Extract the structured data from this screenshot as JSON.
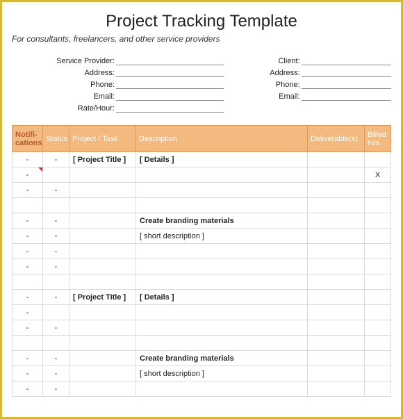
{
  "title": "Project Tracking Template",
  "subtitle": "For consultants, freelancers, and other service providers",
  "info_left": {
    "service_provider": "Service Provider:",
    "address": "Address:",
    "phone": "Phone:",
    "email": "Email:",
    "rate": "Rate/Hour:"
  },
  "info_right": {
    "client": "Client:",
    "address": "Address:",
    "phone": "Phone:",
    "email": "Email:"
  },
  "headers": {
    "notifications": "Notifi-cations",
    "status": "Status",
    "project_task": "Project / Task",
    "description": "Description",
    "deliverables": "Deliverable(s)",
    "billed_hrs": "Billed Hrs"
  },
  "rows": [
    {
      "notif": "-",
      "status": "-",
      "project": "[ Project Title ]",
      "project_bold": true,
      "desc": "[ Details ]",
      "desc_bold": true,
      "deliv": "",
      "hrs": "",
      "marker": false
    },
    {
      "notif": "-",
      "status": "",
      "project": "",
      "project_bold": false,
      "desc": "",
      "desc_bold": false,
      "deliv": "",
      "hrs": "X",
      "marker": true
    },
    {
      "notif": "-",
      "status": "-",
      "project": "",
      "project_bold": false,
      "desc": "",
      "desc_bold": false,
      "deliv": "",
      "hrs": "",
      "marker": false
    },
    {
      "notif": "",
      "status": "",
      "project": "",
      "project_bold": false,
      "desc": "",
      "desc_bold": false,
      "deliv": "",
      "hrs": "",
      "marker": false
    },
    {
      "notif": "-",
      "status": "-",
      "project": "",
      "project_bold": false,
      "desc": "Create branding materials",
      "desc_bold": true,
      "deliv": "",
      "hrs": "",
      "tall": true,
      "marker": false
    },
    {
      "notif": "-",
      "status": "-",
      "project": "",
      "project_bold": false,
      "desc": "[ short description ]",
      "desc_bold": false,
      "deliv": "",
      "hrs": "",
      "marker": false
    },
    {
      "notif": "-",
      "status": "-",
      "project": "",
      "project_bold": false,
      "desc": "",
      "desc_bold": false,
      "deliv": "",
      "hrs": "",
      "marker": false
    },
    {
      "notif": "-",
      "status": "-",
      "project": "",
      "project_bold": false,
      "desc": "",
      "desc_bold": false,
      "deliv": "",
      "hrs": "",
      "marker": false
    },
    {
      "notif": "",
      "status": "",
      "project": "",
      "project_bold": false,
      "desc": "",
      "desc_bold": false,
      "deliv": "",
      "hrs": "",
      "marker": false
    },
    {
      "notif": "-",
      "status": "-",
      "project": "[ Project Title ]",
      "project_bold": true,
      "desc": "[ Details ]",
      "desc_bold": true,
      "deliv": "",
      "hrs": "",
      "marker": false
    },
    {
      "notif": "-",
      "status": "",
      "project": "",
      "project_bold": false,
      "desc": "",
      "desc_bold": false,
      "deliv": "",
      "hrs": "",
      "marker": false
    },
    {
      "notif": "-",
      "status": "-",
      "project": "",
      "project_bold": false,
      "desc": "",
      "desc_bold": false,
      "deliv": "",
      "hrs": "",
      "marker": false
    },
    {
      "notif": "",
      "status": "",
      "project": "",
      "project_bold": false,
      "desc": "",
      "desc_bold": false,
      "deliv": "",
      "hrs": "",
      "marker": false
    },
    {
      "notif": "-",
      "status": "-",
      "project": "",
      "project_bold": false,
      "desc": "Create branding materials",
      "desc_bold": true,
      "deliv": "",
      "hrs": "",
      "tall": true,
      "marker": false
    },
    {
      "notif": "-",
      "status": "-",
      "project": "",
      "project_bold": false,
      "desc": "[ short description ]",
      "desc_bold": false,
      "deliv": "",
      "hrs": "",
      "marker": false
    },
    {
      "notif": "-",
      "status": "-",
      "project": "",
      "project_bold": false,
      "desc": "",
      "desc_bold": false,
      "deliv": "",
      "hrs": "",
      "marker": false
    }
  ]
}
